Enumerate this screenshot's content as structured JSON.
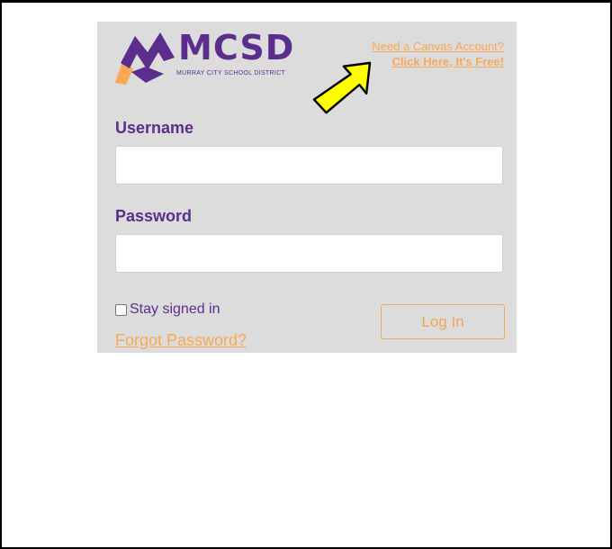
{
  "logo": {
    "name": "MCSD",
    "subtitle": "MURRAY CITY SCHOOL DISTRICT"
  },
  "promo": {
    "line1": "Need a Canvas Account?",
    "line2": "Click Here, It's Free!"
  },
  "form": {
    "username_label": "Username",
    "username_value": "",
    "password_label": "Password",
    "password_value": "",
    "remember_label": "Stay signed in",
    "remember_checked": false,
    "forgot_label": "Forgot Password?",
    "submit_label": "Log In"
  },
  "colors": {
    "brand_purple": "#5b2d8c",
    "brand_orange": "#f9a856",
    "card_background": "#dcdcdc",
    "arrow_fill": "#ffff00"
  },
  "icons": {
    "logo": "mcsd-m-mark-icon",
    "arrow": "pointer-arrow-icon"
  }
}
